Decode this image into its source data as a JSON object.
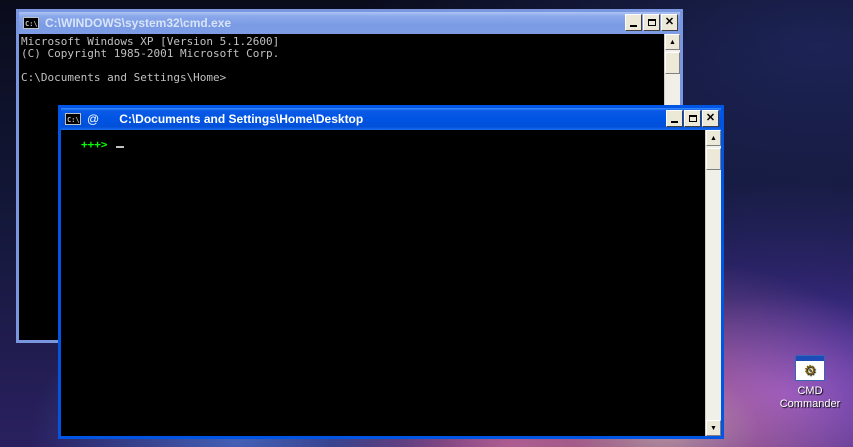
{
  "back_window": {
    "title": "C:\\WINDOWS\\system32\\cmd.exe",
    "console_lines": [
      "Microsoft Windows XP [Version 5.1.2600]",
      "(C) Copyright 1985-2001 Microsoft Corp.",
      "",
      "C:\\Documents and Settings\\Home>"
    ]
  },
  "front_window": {
    "title_prefix": "@",
    "title": "C:\\Documents and Settings\\Home\\Desktop",
    "prompt": "+++>"
  },
  "desktop_icon": {
    "label_line1": "CMD",
    "label_line2": "Commander",
    "icon": "cmd-commander-icon"
  },
  "colors": {
    "active_titlebar": "#0054e3",
    "inactive_titlebar": "#7b9be4",
    "console_text": "#c0c0c0",
    "prompt_text": "#00ff00"
  }
}
